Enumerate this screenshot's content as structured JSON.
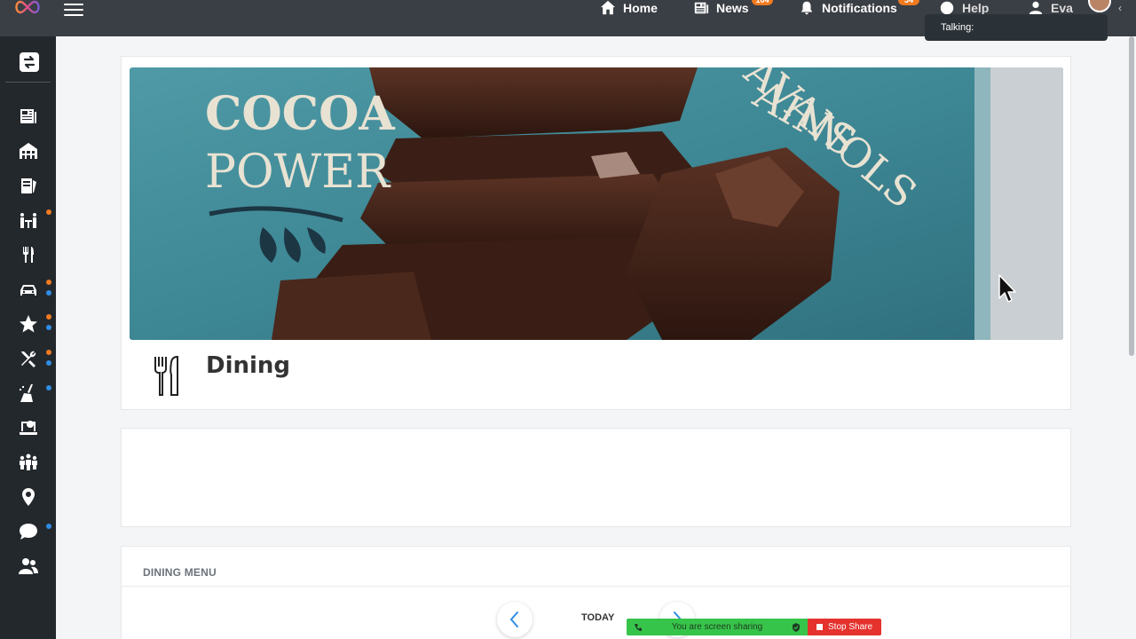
{
  "topbar": {
    "nav": {
      "home": "Home",
      "news": "News",
      "news_badge": "104",
      "notifications": "Notifications",
      "notifications_badge": "34",
      "help": "Help",
      "user": "Eva"
    },
    "talking": "Talking:"
  },
  "sidebar": {
    "items": [
      {
        "icon": "newspaper-icon",
        "dot": null
      },
      {
        "icon": "building-icon",
        "dot": null
      },
      {
        "icon": "notes-icon",
        "dot": null
      },
      {
        "icon": "events-icon",
        "dot": "orange"
      },
      {
        "icon": "fork-knife-icon",
        "dot": null
      },
      {
        "icon": "car-icon",
        "dot": "orange+blue"
      },
      {
        "icon": "star-icon",
        "dot": "orange+blue"
      },
      {
        "icon": "tools-icon",
        "dot": "orange+blue"
      },
      {
        "icon": "cleaning-icon",
        "dot": "blue"
      },
      {
        "icon": "laptop-help-icon",
        "dot": null
      },
      {
        "icon": "group-icon",
        "dot": null
      },
      {
        "icon": "location-pin-icon",
        "dot": null
      },
      {
        "icon": "chat-icon",
        "dot": "blue"
      },
      {
        "icon": "users-icon",
        "dot": null
      }
    ]
  },
  "banner": {
    "left_text": [
      "COCOA",
      "POWER"
    ],
    "right_text": [
      "AINS",
      "AVANOLS"
    ]
  },
  "page": {
    "title": "Dining"
  },
  "menu": {
    "heading": "DINING MENU",
    "day": "TODAY"
  },
  "sharebar": {
    "message": "You are screen sharing",
    "stop": "Stop Share"
  },
  "colors": {
    "topbar": "#3a3f45",
    "sidebar": "#23282d",
    "badge": "#f07b21",
    "dot_blue": "#2f8de4",
    "share_green": "#37c44a",
    "share_red": "#e5322d"
  }
}
